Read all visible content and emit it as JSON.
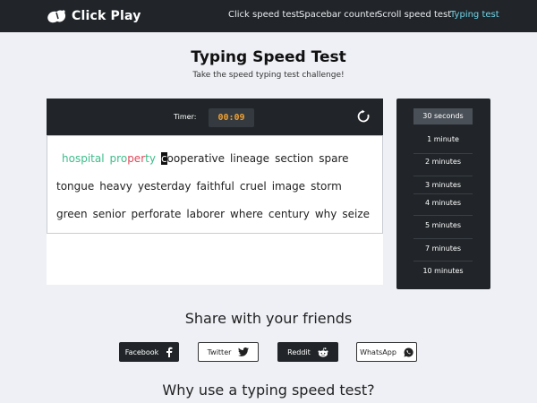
{
  "brand": {
    "name": "Click Play"
  },
  "nav": {
    "links": [
      {
        "label": "Click speed test"
      },
      {
        "label": "Spacebar counter"
      },
      {
        "label": "Scroll speed test"
      },
      {
        "label": "Typing test",
        "active": true
      }
    ],
    "active_color": "#6fd4e8"
  },
  "header": {
    "title": "Typing Speed Test",
    "subtitle": "Take the speed typing test challenge!"
  },
  "test": {
    "timer_label": "Timer:",
    "timer_value": "00:09",
    "reset_icon": "reset-icon",
    "typed": {
      "correct_word": "hospital",
      "current_word_correct": "pro",
      "current_word_wrong": "per",
      "current_word_rest": "ty",
      "correct_color": "#3dbd8a",
      "error_color": "#e0485a"
    },
    "cursor_char": "c",
    "rest_of_word": "ooperative",
    "line1_words": [
      "lineage",
      "section",
      "spare"
    ],
    "line2_words": [
      "tongue",
      "heavy",
      "yesterday",
      "faithful",
      "cruel",
      "image",
      "storm"
    ],
    "line3_words": [
      "green",
      "senior",
      "perforate",
      "laborer",
      "where",
      "century",
      "why",
      "seize"
    ]
  },
  "durations": {
    "options": [
      "30 seconds",
      "1 minute",
      "2 minutes",
      "3 minutes",
      "4 minutes",
      "5 minutes",
      "7 minutes",
      "10 minutes"
    ],
    "selected": "30 seconds"
  },
  "share": {
    "title": "Share with your friends",
    "buttons": [
      {
        "label": "Facebook",
        "icon": "facebook-icon",
        "style": "dark"
      },
      {
        "label": "Twitter",
        "icon": "twitter-icon",
        "style": "light"
      },
      {
        "label": "Reddit",
        "icon": "reddit-icon",
        "style": "dark"
      },
      {
        "label": "WhatsApp",
        "icon": "whatsapp-icon",
        "style": "light"
      }
    ]
  },
  "why": {
    "title": "Why use a typing speed test?"
  }
}
